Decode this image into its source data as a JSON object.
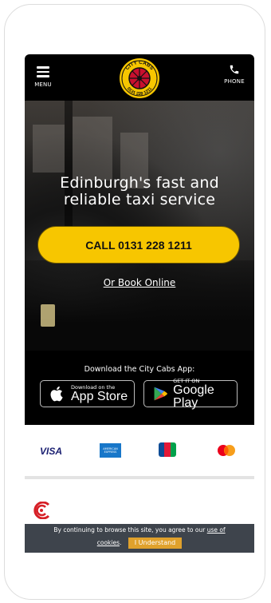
{
  "header": {
    "menu_label": "MENU",
    "phone_label": "PHONE",
    "logo_top_text": "CITY CABS",
    "logo_bottom_text": "0131 228 1211"
  },
  "hero": {
    "title_line1": "Edinburgh's fast and",
    "title_line2": "reliable taxi service",
    "call_button": "CALL 0131 228 1211",
    "book_link": "Or Book Online"
  },
  "apps": {
    "title": "Download the City Cabs App:",
    "apple_small": "Download on the",
    "apple_big": "App Store",
    "google_small": "GET IT ON",
    "google_big": "Google Play"
  },
  "payments": {
    "visa": "VISA",
    "amex": "AMERICAN EXPRESS"
  },
  "cookie": {
    "text": "By continuing to browse this site, you agree to our",
    "link_part1": "use of",
    "link_part2": "cookies",
    "period": ".",
    "button": "I Understand"
  },
  "colors": {
    "accent": "#f7c600",
    "topbar": "#000000",
    "cookie_bg": "#3e444c",
    "cookie_button": "#e0a12c"
  }
}
